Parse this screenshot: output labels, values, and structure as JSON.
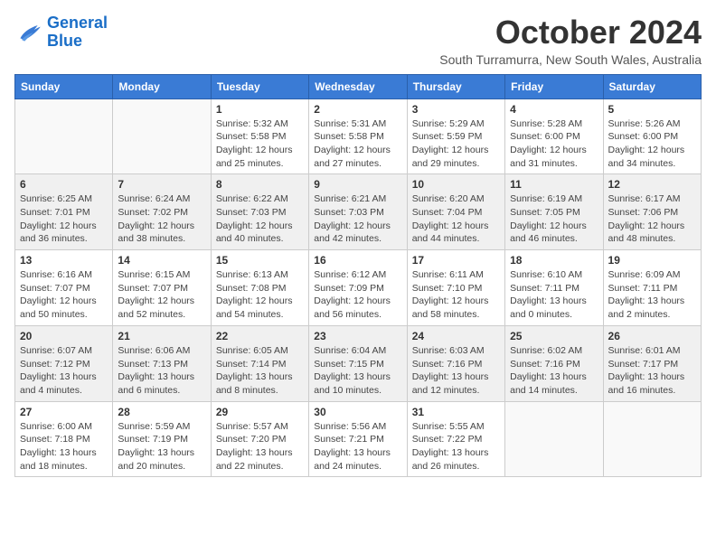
{
  "logo": {
    "line1": "General",
    "line2": "Blue"
  },
  "title": "October 2024",
  "subtitle": "South Turramurra, New South Wales, Australia",
  "days_of_week": [
    "Sunday",
    "Monday",
    "Tuesday",
    "Wednesday",
    "Thursday",
    "Friday",
    "Saturday"
  ],
  "weeks": [
    [
      {
        "day": "",
        "info": ""
      },
      {
        "day": "",
        "info": ""
      },
      {
        "day": "1",
        "info": "Sunrise: 5:32 AM\nSunset: 5:58 PM\nDaylight: 12 hours\nand 25 minutes."
      },
      {
        "day": "2",
        "info": "Sunrise: 5:31 AM\nSunset: 5:58 PM\nDaylight: 12 hours\nand 27 minutes."
      },
      {
        "day": "3",
        "info": "Sunrise: 5:29 AM\nSunset: 5:59 PM\nDaylight: 12 hours\nand 29 minutes."
      },
      {
        "day": "4",
        "info": "Sunrise: 5:28 AM\nSunset: 6:00 PM\nDaylight: 12 hours\nand 31 minutes."
      },
      {
        "day": "5",
        "info": "Sunrise: 5:26 AM\nSunset: 6:00 PM\nDaylight: 12 hours\nand 34 minutes."
      }
    ],
    [
      {
        "day": "6",
        "info": "Sunrise: 6:25 AM\nSunset: 7:01 PM\nDaylight: 12 hours\nand 36 minutes."
      },
      {
        "day": "7",
        "info": "Sunrise: 6:24 AM\nSunset: 7:02 PM\nDaylight: 12 hours\nand 38 minutes."
      },
      {
        "day": "8",
        "info": "Sunrise: 6:22 AM\nSunset: 7:03 PM\nDaylight: 12 hours\nand 40 minutes."
      },
      {
        "day": "9",
        "info": "Sunrise: 6:21 AM\nSunset: 7:03 PM\nDaylight: 12 hours\nand 42 minutes."
      },
      {
        "day": "10",
        "info": "Sunrise: 6:20 AM\nSunset: 7:04 PM\nDaylight: 12 hours\nand 44 minutes."
      },
      {
        "day": "11",
        "info": "Sunrise: 6:19 AM\nSunset: 7:05 PM\nDaylight: 12 hours\nand 46 minutes."
      },
      {
        "day": "12",
        "info": "Sunrise: 6:17 AM\nSunset: 7:06 PM\nDaylight: 12 hours\nand 48 minutes."
      }
    ],
    [
      {
        "day": "13",
        "info": "Sunrise: 6:16 AM\nSunset: 7:07 PM\nDaylight: 12 hours\nand 50 minutes."
      },
      {
        "day": "14",
        "info": "Sunrise: 6:15 AM\nSunset: 7:07 PM\nDaylight: 12 hours\nand 52 minutes."
      },
      {
        "day": "15",
        "info": "Sunrise: 6:13 AM\nSunset: 7:08 PM\nDaylight: 12 hours\nand 54 minutes."
      },
      {
        "day": "16",
        "info": "Sunrise: 6:12 AM\nSunset: 7:09 PM\nDaylight: 12 hours\nand 56 minutes."
      },
      {
        "day": "17",
        "info": "Sunrise: 6:11 AM\nSunset: 7:10 PM\nDaylight: 12 hours\nand 58 minutes."
      },
      {
        "day": "18",
        "info": "Sunrise: 6:10 AM\nSunset: 7:11 PM\nDaylight: 13 hours\nand 0 minutes."
      },
      {
        "day": "19",
        "info": "Sunrise: 6:09 AM\nSunset: 7:11 PM\nDaylight: 13 hours\nand 2 minutes."
      }
    ],
    [
      {
        "day": "20",
        "info": "Sunrise: 6:07 AM\nSunset: 7:12 PM\nDaylight: 13 hours\nand 4 minutes."
      },
      {
        "day": "21",
        "info": "Sunrise: 6:06 AM\nSunset: 7:13 PM\nDaylight: 13 hours\nand 6 minutes."
      },
      {
        "day": "22",
        "info": "Sunrise: 6:05 AM\nSunset: 7:14 PM\nDaylight: 13 hours\nand 8 minutes."
      },
      {
        "day": "23",
        "info": "Sunrise: 6:04 AM\nSunset: 7:15 PM\nDaylight: 13 hours\nand 10 minutes."
      },
      {
        "day": "24",
        "info": "Sunrise: 6:03 AM\nSunset: 7:16 PM\nDaylight: 13 hours\nand 12 minutes."
      },
      {
        "day": "25",
        "info": "Sunrise: 6:02 AM\nSunset: 7:16 PM\nDaylight: 13 hours\nand 14 minutes."
      },
      {
        "day": "26",
        "info": "Sunrise: 6:01 AM\nSunset: 7:17 PM\nDaylight: 13 hours\nand 16 minutes."
      }
    ],
    [
      {
        "day": "27",
        "info": "Sunrise: 6:00 AM\nSunset: 7:18 PM\nDaylight: 13 hours\nand 18 minutes."
      },
      {
        "day": "28",
        "info": "Sunrise: 5:59 AM\nSunset: 7:19 PM\nDaylight: 13 hours\nand 20 minutes."
      },
      {
        "day": "29",
        "info": "Sunrise: 5:57 AM\nSunset: 7:20 PM\nDaylight: 13 hours\nand 22 minutes."
      },
      {
        "day": "30",
        "info": "Sunrise: 5:56 AM\nSunset: 7:21 PM\nDaylight: 13 hours\nand 24 minutes."
      },
      {
        "day": "31",
        "info": "Sunrise: 5:55 AM\nSunset: 7:22 PM\nDaylight: 13 hours\nand 26 minutes."
      },
      {
        "day": "",
        "info": ""
      },
      {
        "day": "",
        "info": ""
      }
    ]
  ]
}
